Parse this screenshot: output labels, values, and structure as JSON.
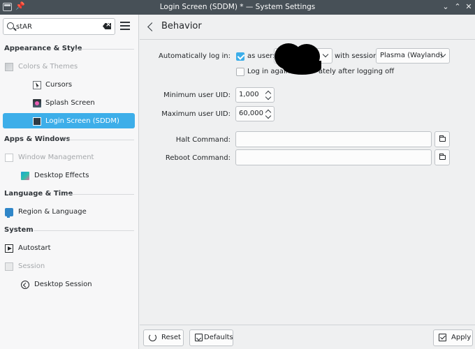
{
  "window": {
    "title": "Login Screen (SDDM) * — System Settings",
    "pin_glyph": "📌",
    "buttons": [
      "chevron-down-icon",
      "chevron-up-icon",
      "close-icon"
    ]
  },
  "sidebar": {
    "search": {
      "value": "stAR",
      "placeholder": ""
    },
    "sections": [
      {
        "title": "Appearance & Style",
        "items": [
          {
            "label": "Colors & Themes",
            "icon": "colors-themes-icon",
            "dimmed": true
          },
          {
            "label": "Cursors",
            "icon": "cursor-icon"
          },
          {
            "label": "Splash Screen",
            "icon": "splash-screen-icon"
          },
          {
            "label": "Login Screen (SDDM)",
            "icon": "login-screen-icon",
            "selected": true
          }
        ]
      },
      {
        "title": "Apps & Windows",
        "items": [
          {
            "label": "Window Management",
            "icon": "window-management-icon",
            "dimmed": true
          },
          {
            "label": "Desktop Effects",
            "icon": "desktop-effects-icon"
          }
        ]
      },
      {
        "title": "Language & Time",
        "items": [
          {
            "label": "Region & Language",
            "icon": "region-language-icon"
          }
        ]
      },
      {
        "title": "System",
        "items": [
          {
            "label": "Autostart",
            "icon": "autostart-icon"
          },
          {
            "label": "Session",
            "icon": "session-icon",
            "dimmed": true
          },
          {
            "label": "Desktop Session",
            "icon": "desktop-session-icon"
          }
        ]
      }
    ]
  },
  "header": {
    "title": "Behavior"
  },
  "behavior": {
    "autologin_label": "Automatically log in:",
    "autologin_checked": true,
    "as_user_label": "as user:",
    "with_session_label": "with session",
    "session_value": "Plasma (Wayland)",
    "relogin_label": "Log in again immediately after logging off",
    "relogin_visible": "Log in again",
    "relogin_tail": "ately after logging off",
    "relogin_checked": false,
    "min_uid_label": "Minimum user UID:",
    "min_uid_value": "1,000",
    "max_uid_label": "Maximum user UID:",
    "max_uid_value": "60,000",
    "halt_label": "Halt Command:",
    "halt_value": "",
    "reboot_label": "Reboot Command:",
    "reboot_value": ""
  },
  "footer": {
    "reset_label": "Reset",
    "defaults_label": "Defaults",
    "apply_label": "Apply"
  },
  "colors": {
    "accent": "#3daee9",
    "titlebar": "#475057",
    "window_bg": "#eff0f1"
  }
}
